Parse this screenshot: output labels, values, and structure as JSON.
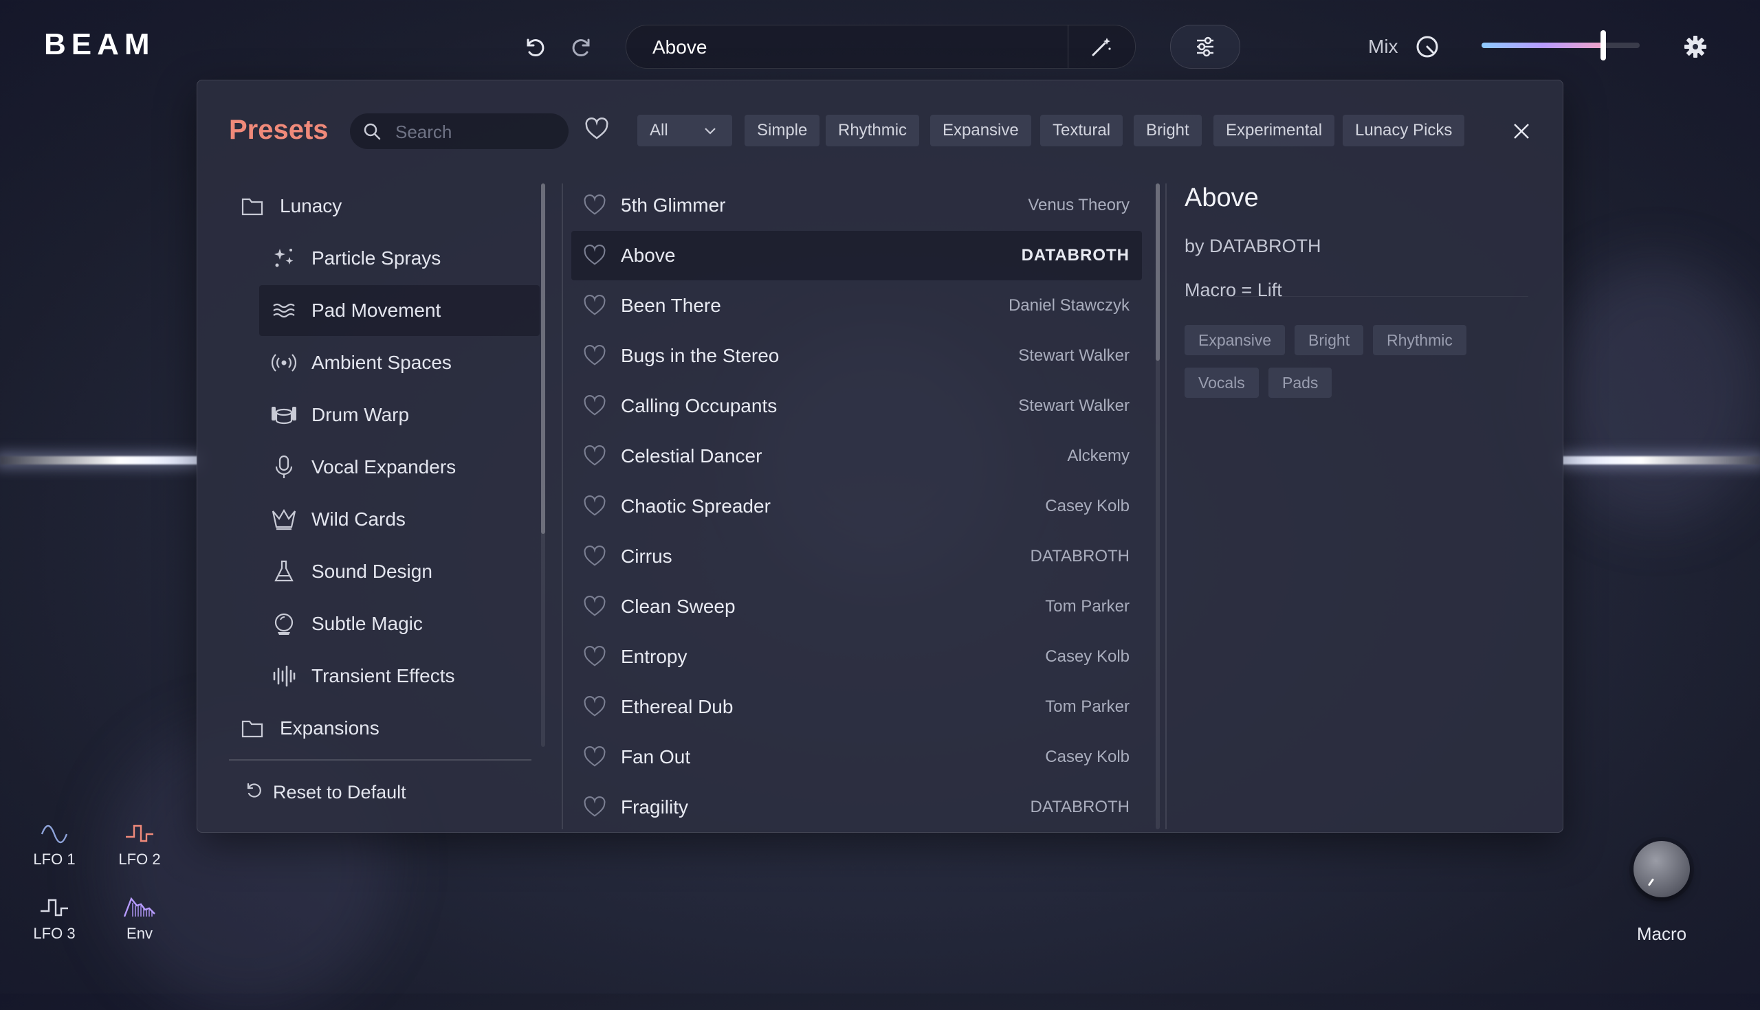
{
  "app": {
    "logo": "BEAM"
  },
  "header": {
    "current_preset": "Above",
    "mix_label": "Mix",
    "mix_value": 0.77
  },
  "presets_panel": {
    "title": "Presets",
    "search_placeholder": "Search",
    "filters": [
      "All",
      "Simple",
      "Rhythmic",
      "Expansive",
      "Textural",
      "Bright",
      "Experimental",
      "Lunacy Picks"
    ],
    "categories": [
      {
        "label": "Lunacy",
        "icon": "folder-icon",
        "level": 0
      },
      {
        "label": "Particle Sprays",
        "icon": "sparkle-icon",
        "level": 1
      },
      {
        "label": "Pad Movement",
        "icon": "waves-icon",
        "level": 1,
        "selected": true
      },
      {
        "label": "Ambient Spaces",
        "icon": "broadcast-icon",
        "level": 1
      },
      {
        "label": "Drum Warp",
        "icon": "drum-icon",
        "level": 1
      },
      {
        "label": "Vocal Expanders",
        "icon": "microphone-icon",
        "level": 1
      },
      {
        "label": "Wild Cards",
        "icon": "jester-icon",
        "level": 1
      },
      {
        "label": "Sound Design",
        "icon": "flask-icon",
        "level": 1
      },
      {
        "label": "Subtle Magic",
        "icon": "crystal-ball-icon",
        "level": 1
      },
      {
        "label": "Transient Effects",
        "icon": "bars-icon",
        "level": 1
      },
      {
        "label": "Expansions",
        "icon": "folder-icon",
        "level": 0
      }
    ],
    "reset_label": "Reset to Default",
    "presets": [
      {
        "name": "5th Glimmer",
        "author": "Venus Theory"
      },
      {
        "name": "Above",
        "author": "DATABROTH",
        "selected": true
      },
      {
        "name": "Been There",
        "author": "Daniel Stawczyk"
      },
      {
        "name": "Bugs in the Stereo",
        "author": "Stewart Walker"
      },
      {
        "name": "Calling Occupants",
        "author": "Stewart Walker"
      },
      {
        "name": "Celestial Dancer",
        "author": "Alckemy"
      },
      {
        "name": "Chaotic Spreader",
        "author": "Casey Kolb"
      },
      {
        "name": "Cirrus",
        "author": "DATABROTH"
      },
      {
        "name": "Clean Sweep",
        "author": "Tom Parker"
      },
      {
        "name": "Entropy",
        "author": "Casey Kolb"
      },
      {
        "name": "Ethereal Dub",
        "author": "Tom Parker"
      },
      {
        "name": "Fan Out",
        "author": "Casey Kolb"
      },
      {
        "name": "Fragility",
        "author": "DATABROTH"
      }
    ],
    "detail": {
      "title": "Above",
      "by": "by DATABROTH",
      "macro": "Macro = Lift",
      "tags": [
        "Expansive",
        "Bright",
        "Rhythmic",
        "Vocals",
        "Pads"
      ]
    }
  },
  "modulators": [
    {
      "label": "LFO 1",
      "icon": "sine-wave-icon",
      "color": "#8ea3d9"
    },
    {
      "label": "LFO 2",
      "icon": "square-wave-icon",
      "color": "#f08a7a"
    },
    {
      "label": "LFO 3",
      "icon": "square-wave-icon",
      "color": "#d9dbe6"
    },
    {
      "label": "Env",
      "icon": "envelope-icon",
      "color": "#b79cff"
    }
  ],
  "macro": {
    "label": "Macro"
  },
  "colors": {
    "accent": "#f08a7a",
    "panel": "#2c2f40"
  }
}
